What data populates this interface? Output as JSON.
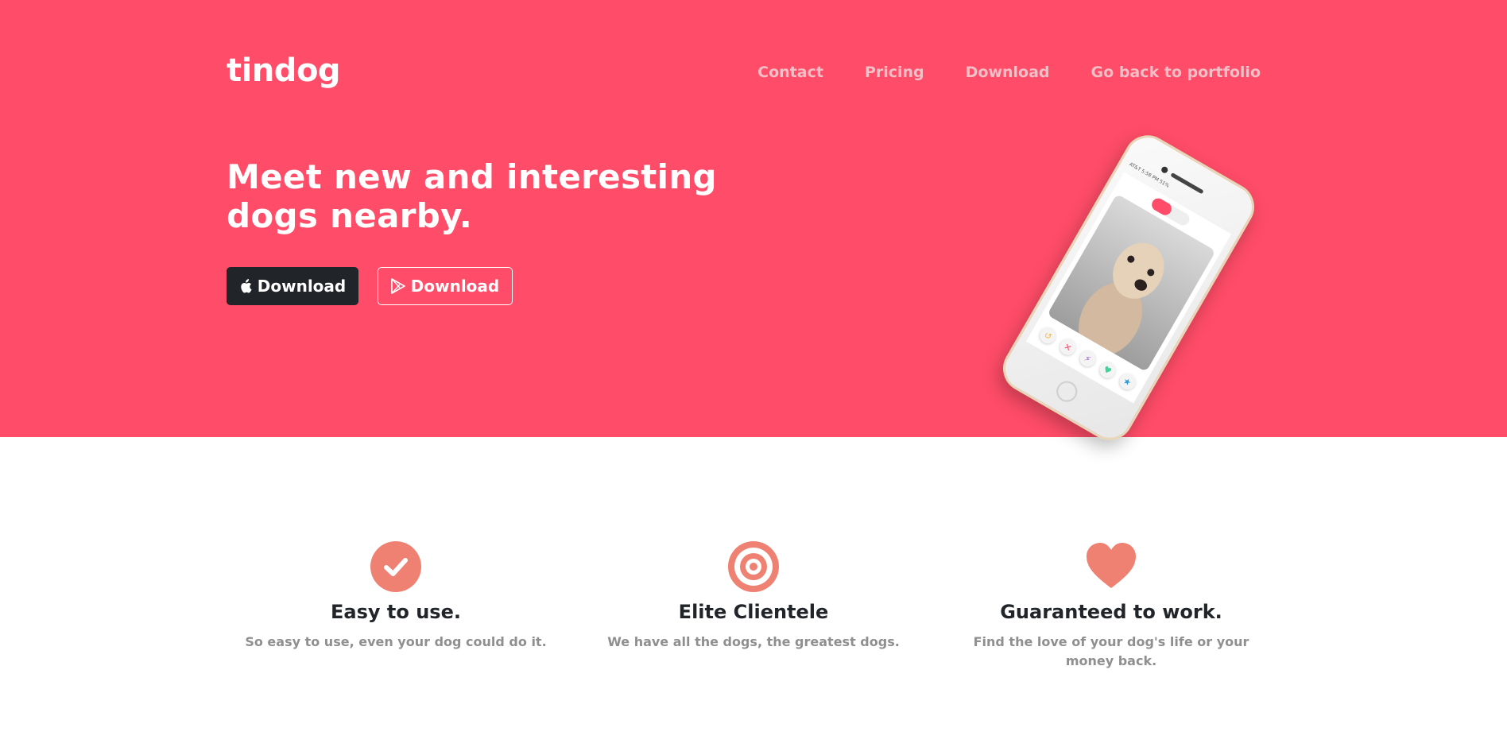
{
  "brand": "tindog",
  "nav": {
    "contact": "Contact",
    "pricing": "Pricing",
    "download": "Download",
    "portfolio": "Go back to portfolio"
  },
  "hero": {
    "headline_line1": "Meet new and interesting",
    "headline_line2": "dogs nearby.",
    "ios_button": "Download",
    "android_button": "Download",
    "background_color": "#ff4c68"
  },
  "phone": {
    "status_text": "AT&T  5:58 PM  51%"
  },
  "features": [
    {
      "icon": "check-circle-icon",
      "title": "Easy to use.",
      "text": "So easy to use, even your dog could do it."
    },
    {
      "icon": "bullseye-icon",
      "title": "Elite Clientele",
      "text": "We have all the dogs, the greatest dogs."
    },
    {
      "icon": "heart-icon",
      "title": "Guaranteed to work.",
      "text": "Find the love of your dog's life or your money back."
    }
  ],
  "colors": {
    "accent": "#ff4c68",
    "icon": "#ef8172",
    "dark_button": "#212529",
    "muted_text": "#8f8f8f"
  }
}
